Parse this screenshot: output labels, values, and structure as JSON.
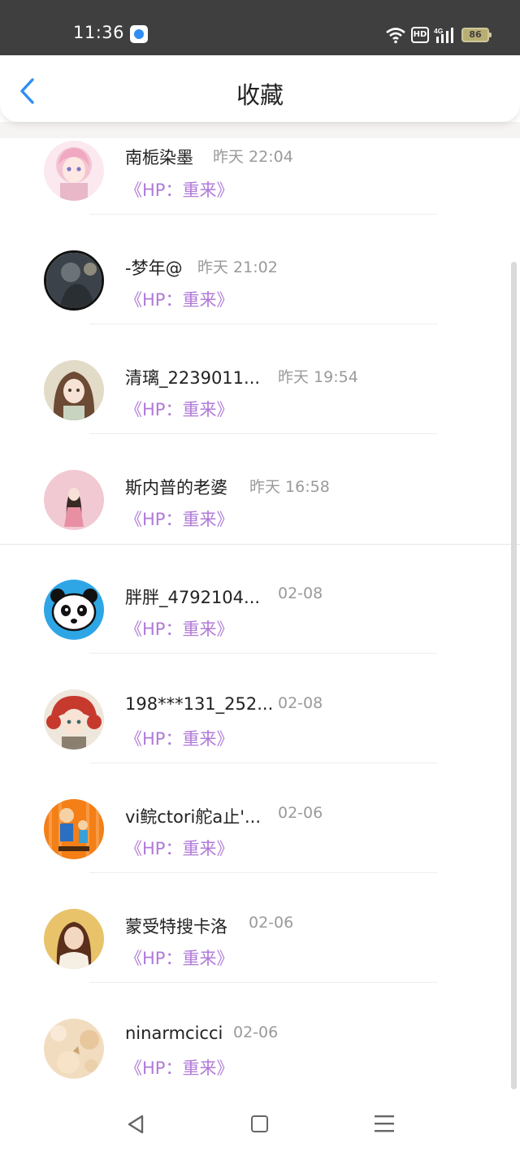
{
  "status_bar": {
    "time": "11:36",
    "network": "4G",
    "hd_label": "HD",
    "battery_level": "86",
    "icons": [
      "app-notification-icon",
      "wifi-icon",
      "hd-icon",
      "signal-icon",
      "battery-icon"
    ]
  },
  "header": {
    "title": "收藏",
    "back_icon": "chevron-left-icon",
    "accent_color": "#2f8ef5"
  },
  "items": [
    {
      "name": "南栀染墨",
      "time": "昨天 22:04",
      "link": "《HP：重来》"
    },
    {
      "name": "-梦年@",
      "time": "昨天 21:02",
      "link": "《HP：重来》"
    },
    {
      "name": "清璃_2239011...",
      "time": "昨天 19:54",
      "link": "《HP：重来》"
    },
    {
      "name": "斯内普的老婆",
      "time": "昨天 16:58",
      "link": "《HP：重来》"
    },
    {
      "name": "胖胖_4792104...",
      "time": "02-08",
      "link": "《HP：重来》"
    },
    {
      "name": "198***131_252...",
      "time": "02-08",
      "link": "《HP：重来》"
    },
    {
      "name": "vi鲩ctori舵a止'...",
      "time": "02-06",
      "link": "《HP：重来》"
    },
    {
      "name": "蒙受特搜卡洛",
      "time": "02-06",
      "link": "《HP：重来》"
    },
    {
      "name": "ninarmcicci",
      "time": "02-06",
      "link": "《HP：重来》"
    }
  ],
  "link_color": "#b07ad8",
  "nav_bar": {
    "icons": [
      "triangle-back-icon",
      "square-home-icon",
      "menu-lines-icon"
    ]
  }
}
